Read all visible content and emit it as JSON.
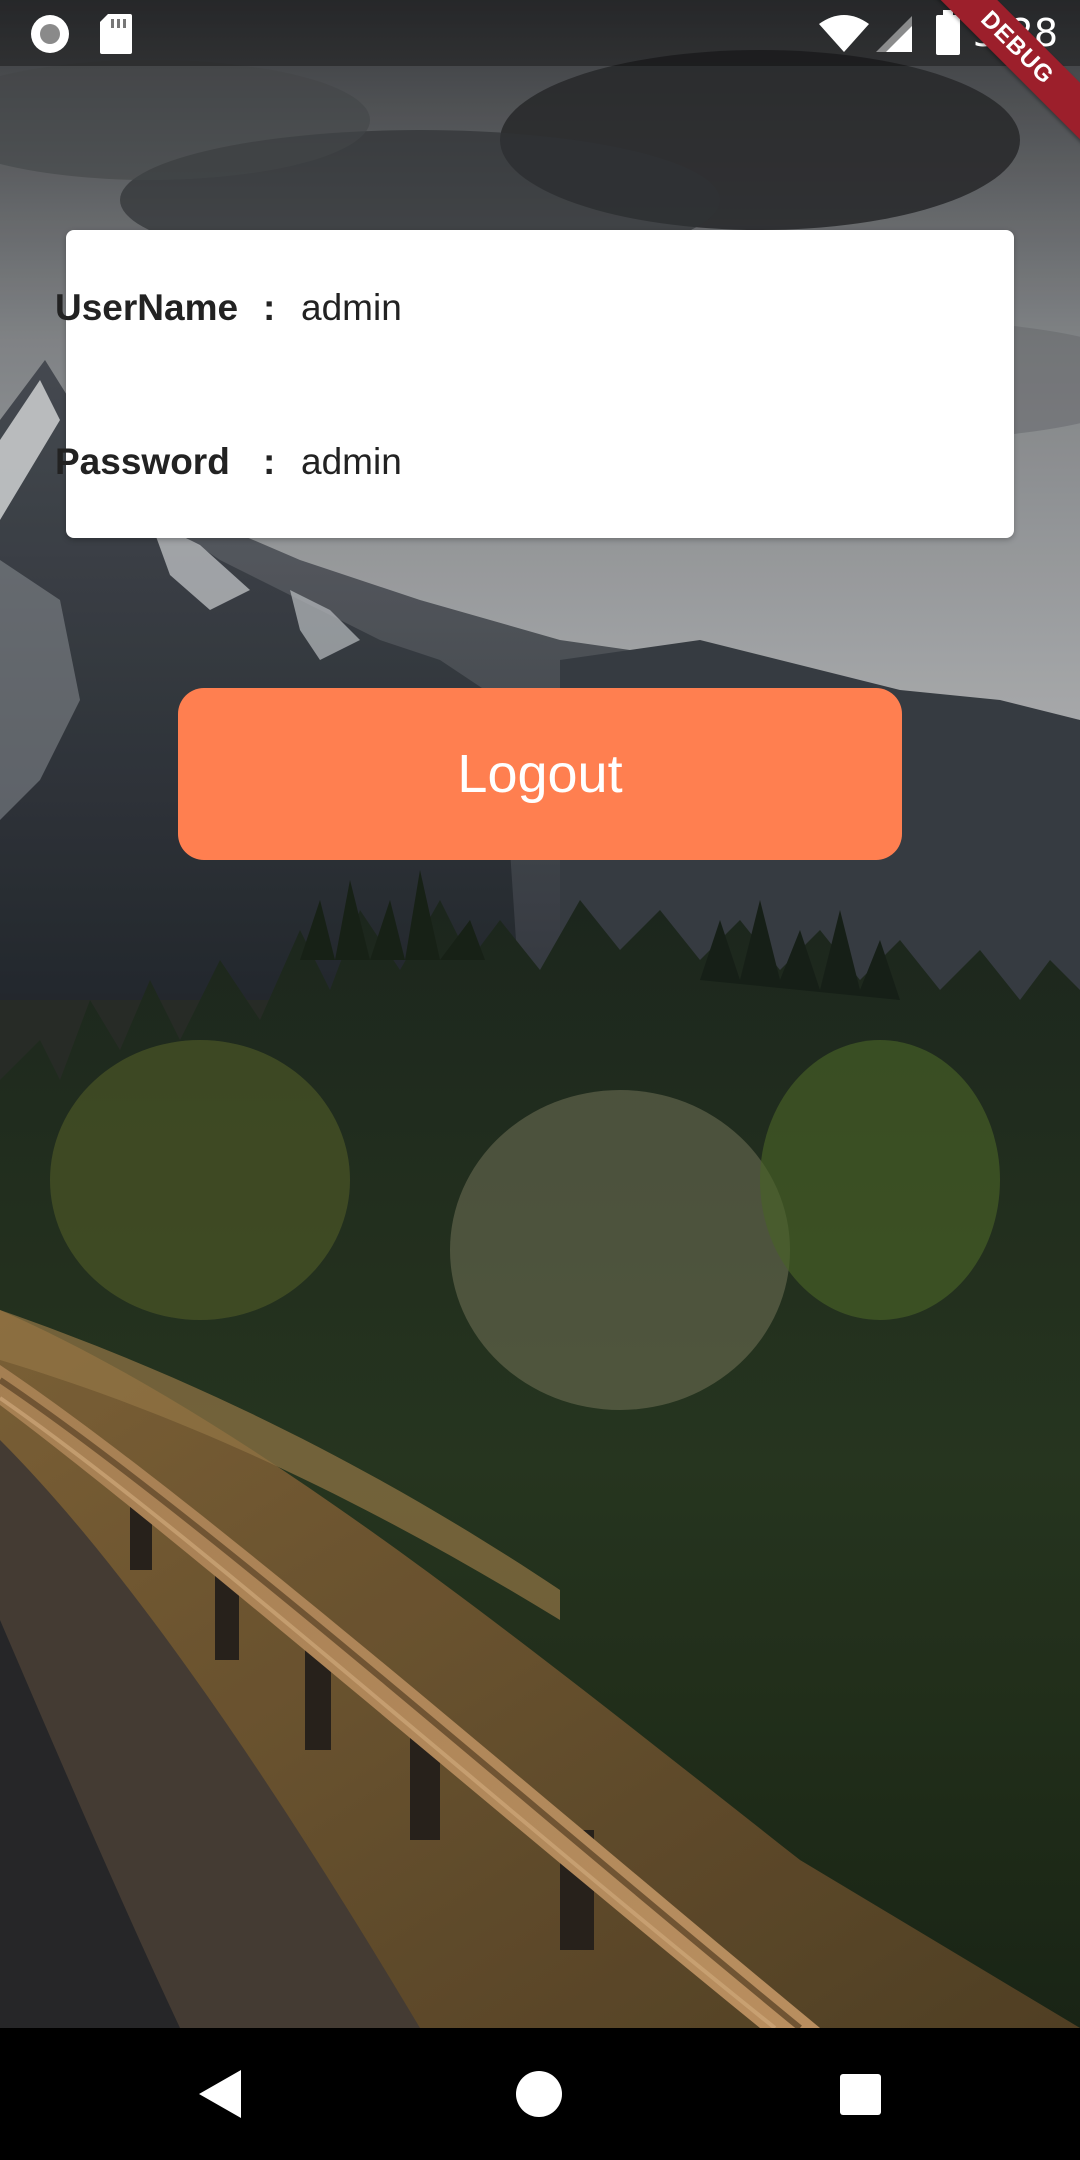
{
  "status_bar": {
    "time": "3:28",
    "icons": [
      "record-icon",
      "sd-card-icon",
      "wifi-icon",
      "cellular-signal-icon",
      "battery-icon"
    ]
  },
  "debug_banner": "DEBUG",
  "credentials": {
    "username_label": "UserName",
    "username_separator": ":",
    "username_value": "admin",
    "password_label": "Password",
    "password_separator": ":",
    "password_value": "admin"
  },
  "logout_label": "Logout",
  "navigation": {
    "back": "back-icon",
    "home": "home-icon",
    "recents": "recents-icon"
  },
  "colors": {
    "button": "#ff7f50",
    "card": "#ffffff",
    "debug_banner": "#9c1f2b"
  }
}
